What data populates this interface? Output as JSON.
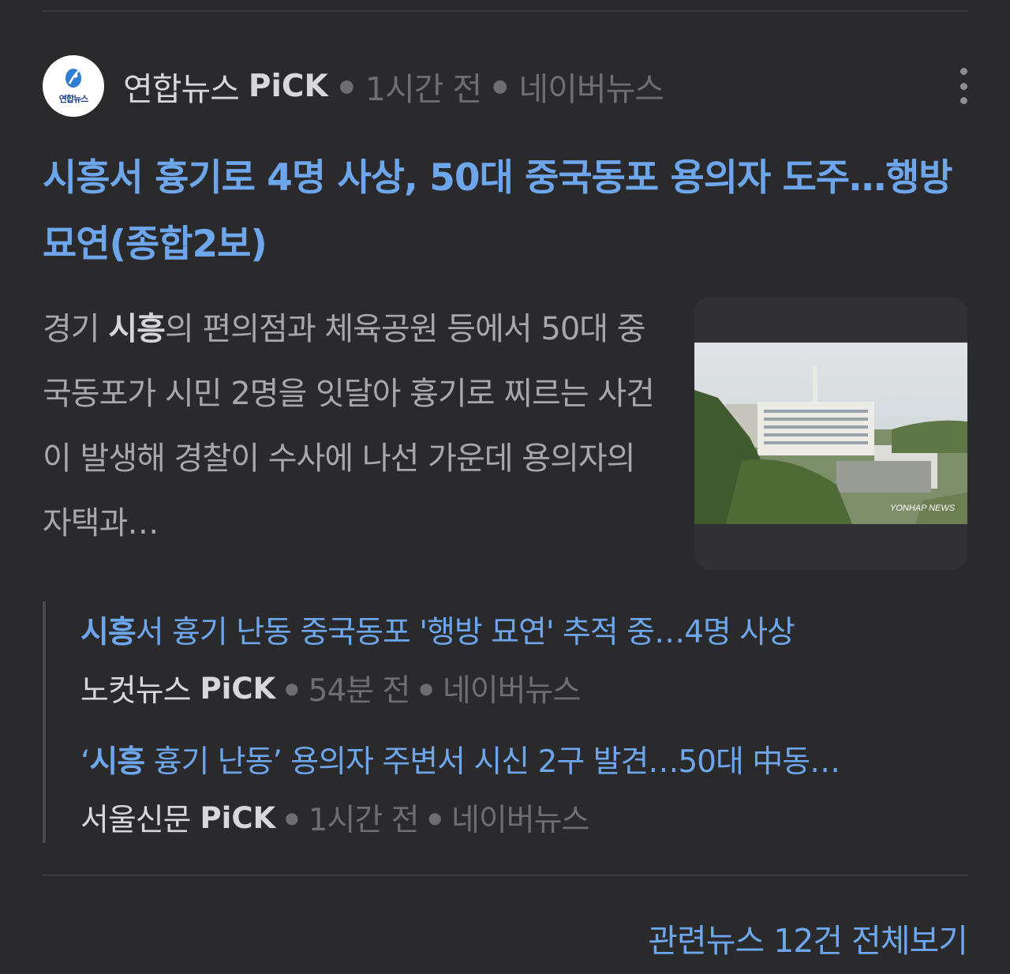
{
  "header": {
    "logo_text": "연합뉴스",
    "press": "연합뉴스",
    "pick": "PiCK",
    "time": "1시간 전",
    "source": "네이버뉴스"
  },
  "article": {
    "headline_keyword": "시흥",
    "headline_rest": "서 흉기로 4명 사상, 50대 중국동포 용의자 도주…행방 묘연(종합2보)",
    "summary_pre": "경기 ",
    "summary_keyword": "시흥",
    "summary_rest": "의 편의점과 체육공원 등에서 50대 중국동포가 시민 2명을 잇달아 흉기로 찌르는 사건이 발생해 경찰이 수사에 나선 가운데 용의자의 자택과…",
    "thumbnail_watermark": "YONHAP NEWS"
  },
  "related": [
    {
      "title_pre": "",
      "title_keyword": "시흥",
      "title_rest": "서 흉기 난동 중국동포 '행방 묘연' 추적 중…4명 사상",
      "press": "노컷뉴스",
      "pick": "PiCK",
      "time": "54분 전",
      "source": "네이버뉴스"
    },
    {
      "title_pre": "‘",
      "title_keyword": "시흥",
      "title_rest": " 흉기 난동’ 용의자 주변서 시신 2구 발견…50대 中동…",
      "press": "서울신문",
      "pick": "PiCK",
      "time": "1시간 전",
      "source": "네이버뉴스"
    }
  ],
  "footer": {
    "view_all": "관련뉴스 12건 전체보기"
  },
  "colors": {
    "background": "#2a2a2c",
    "link_blue": "#6ea6ec",
    "meta_gray": "#6e6e72"
  }
}
